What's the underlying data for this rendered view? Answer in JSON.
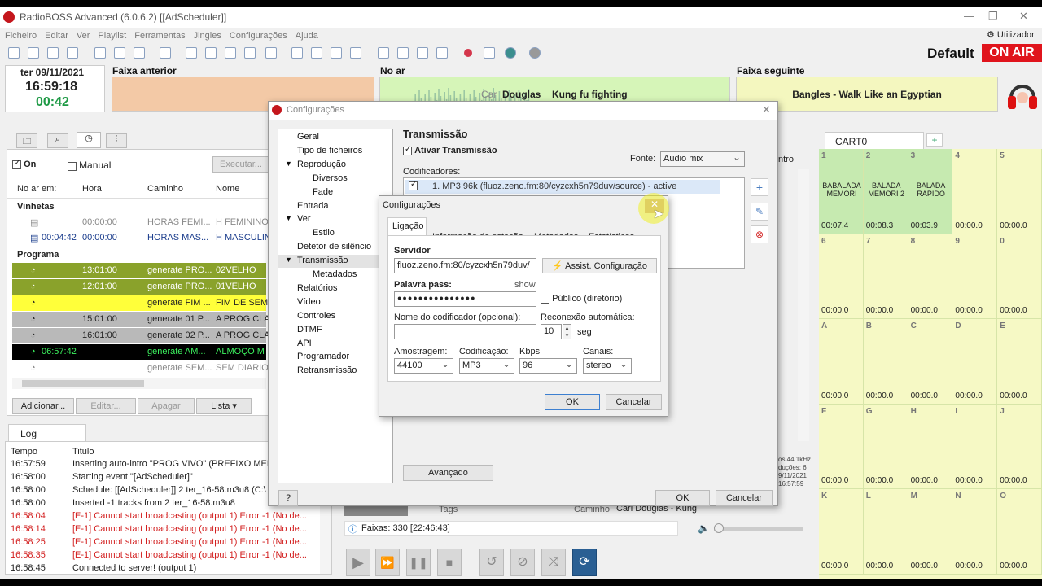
{
  "app": {
    "title": "RadioBOSS Advanced (6.0.6.2) [[AdScheduler]]",
    "user": "Utilizador",
    "profile": "Default",
    "on_air": "ON AIR"
  },
  "menu": [
    "Ficheiro",
    "Editar",
    "Ver",
    "Playlist",
    "Ferramentas",
    "Jingles",
    "Configurações",
    "Ajuda"
  ],
  "clock": {
    "date": "ter 09/11/2021",
    "time": "16:59:18",
    "remaining": "00:42"
  },
  "tracks": {
    "prev_label": "Faixa anterior",
    "now_label": "No ar",
    "now_artist_partial": "Car",
    "now_artist": "Douglas",
    "now_title": "Kung fu fighting",
    "next_label": "Faixa seguinte",
    "next_title": "Bangles - Walk Like an Egyptian"
  },
  "scheduler": {
    "on": "On",
    "manual": "Manual",
    "execute": "Executar...",
    "headers": [
      "No ar em:",
      "Hora",
      "Caminho",
      "Nome"
    ],
    "group1": "Vinhetas",
    "group2": "Programa",
    "rows": [
      {
        "onair": "",
        "hora": "00:00:00",
        "caminho": "HORAS FEMI...",
        "nome": "H FEMININO"
      },
      {
        "onair": "00:04:42",
        "hora": "00:00:00",
        "caminho": "HORAS MAS...",
        "nome": "H MASCULIN"
      },
      {
        "onair": "",
        "hora": "13:01:00",
        "caminho": "generate PRO...",
        "nome": "02VELHO"
      },
      {
        "onair": "",
        "hora": "12:01:00",
        "caminho": "generate PRO...",
        "nome": "01VELHO"
      },
      {
        "onair": "",
        "hora": "",
        "caminho": "generate FIM ...",
        "nome": "FIM DE SEM"
      },
      {
        "onair": "",
        "hora": "15:01:00",
        "caminho": "generate 01 P...",
        "nome": "A PROG CLA"
      },
      {
        "onair": "",
        "hora": "16:01:00",
        "caminho": "generate 02 P...",
        "nome": "A PROG CLA"
      },
      {
        "onair": "06:57:42",
        "hora": "",
        "caminho": "generate AM...",
        "nome": "ALMOÇO M"
      },
      {
        "onair": "",
        "hora": "",
        "caminho": "generate SEM...",
        "nome": "SEM DIARIO"
      }
    ],
    "buttons": {
      "add": "Adicionar...",
      "edit": "Editar...",
      "delete": "Apagar",
      "list": "Lista"
    }
  },
  "log": {
    "tab": "Log",
    "headers": [
      "Tempo",
      "Titulo"
    ],
    "rows": [
      {
        "t": "16:57:59",
        "m": "Inserting auto-intro \"PROG VIVO\" (PREFIXO MEN",
        "err": false
      },
      {
        "t": "16:58:00",
        "m": "Starting event \"[AdScheduler]\"",
        "err": false
      },
      {
        "t": "16:58:00",
        "m": "Schedule: [[AdScheduler]] 2 ter_16-58.m3u8 (C:\\",
        "err": false
      },
      {
        "t": "16:58:00",
        "m": "Inserted -1 tracks from 2 ter_16-58.m3u8",
        "err": false
      },
      {
        "t": "16:58:04",
        "m": "[E-1] Cannot start broadcasting (output 1) Error -1 (No de...",
        "err": true
      },
      {
        "t": "16:58:14",
        "m": "[E-1] Cannot start broadcasting (output 1) Error -1 (No de...",
        "err": true
      },
      {
        "t": "16:58:25",
        "m": "[E-1] Cannot start broadcasting (output 1) Error -1 (No de...",
        "err": true
      },
      {
        "t": "16:58:35",
        "m": "[E-1] Cannot start broadcasting (output 1) Error -1 (No de...",
        "err": true
      },
      {
        "t": "16:58:45",
        "m": "Connected to server! (output 1)",
        "err": false
      }
    ]
  },
  "player": {
    "tags": "Tags",
    "caminho": "Caminho",
    "path": "Carl Douglas - Kung",
    "faixas": "Faixas: 330 [22:46:43]",
    "info1": "os 44.1kHz",
    "info2": "duções: 6",
    "info3": "9/11/2021",
    "info4": "16:57:59",
    "ntro": "ntro"
  },
  "cart": {
    "tab": "CART0",
    "cells": [
      {
        "n": "1",
        "t": "BABALADA MEMORI",
        "d": "00:07.4"
      },
      {
        "n": "2",
        "t": "BALADA MEMORI 2",
        "d": "00:08.3"
      },
      {
        "n": "3",
        "t": "BALADA RAPIDO",
        "d": "00:03.9"
      },
      {
        "n": "4",
        "t": "",
        "d": "00:00.0"
      },
      {
        "n": "5",
        "t": "",
        "d": "00:00.0"
      },
      {
        "n": "6",
        "t": "",
        "d": "00:00.0"
      },
      {
        "n": "7",
        "t": "",
        "d": "00:00.0"
      },
      {
        "n": "8",
        "t": "",
        "d": "00:00.0"
      },
      {
        "n": "9",
        "t": "",
        "d": "00:00.0"
      },
      {
        "n": "0",
        "t": "",
        "d": "00:00.0"
      },
      {
        "n": "A",
        "t": "",
        "d": "00:00.0"
      },
      {
        "n": "B",
        "t": "",
        "d": "00:00.0"
      },
      {
        "n": "C",
        "t": "",
        "d": "00:00.0"
      },
      {
        "n": "D",
        "t": "",
        "d": "00:00.0"
      },
      {
        "n": "E",
        "t": "",
        "d": "00:00.0"
      },
      {
        "n": "F",
        "t": "",
        "d": "00:00.0"
      },
      {
        "n": "G",
        "t": "",
        "d": "00:00.0"
      },
      {
        "n": "H",
        "t": "",
        "d": "00:00.0"
      },
      {
        "n": "I",
        "t": "",
        "d": "00:00.0"
      },
      {
        "n": "J",
        "t": "",
        "d": "00:00.0"
      },
      {
        "n": "K",
        "t": "",
        "d": "00:00.0"
      },
      {
        "n": "L",
        "t": "",
        "d": "00:00.0"
      },
      {
        "n": "M",
        "t": "",
        "d": "00:00.0"
      },
      {
        "n": "N",
        "t": "",
        "d": "00:00.0"
      },
      {
        "n": "O",
        "t": "",
        "d": "00:00.0"
      }
    ]
  },
  "settings": {
    "title": "Configurações",
    "tree": [
      "Geral",
      "Tipo de ficheiros",
      "Reprodução",
      "Diversos",
      "Fade",
      "Entrada",
      "Ver",
      "Estilo",
      "Detetor de silêncio",
      "Transmissão",
      "Metadados",
      "Relatórios",
      "Vídeo",
      "Controles",
      "DTMF",
      "API",
      "Programador",
      "Retransmissão"
    ],
    "section": "Transmissão",
    "enable": "Ativar Transmissão",
    "source_label": "Fonte:",
    "source": "Audio mix",
    "encoders_label": "Codificadores:",
    "encoder_item": "1. MP3 96k (fluoz.zeno.fm:80/cyzcxh5n79duv/source) - active",
    "advanced": "Avançado",
    "ok": "OK",
    "cancel": "Cancelar",
    "help": "?"
  },
  "encoder": {
    "title": "Configurações",
    "tabs": [
      "Ligação",
      "Informação da estação",
      "Metadados",
      "Estatísticas"
    ],
    "server_label": "Servidor",
    "server": "fluoz.zeno.fm:80/cyzcxh5n79duv/",
    "assist": "Assist. Configuração",
    "pass_label": "Palavra pass:",
    "show": "show",
    "pass": "●●●●●●●●●●●●●●●",
    "public": "Público (diretório)",
    "name_label": "Nome do codificador (opcional):",
    "name": "",
    "reconnect_label": "Reconexão automática:",
    "reconnect": "10",
    "seg": "seg",
    "sample_label": "Amostragem:",
    "sample": "44100",
    "codec_label": "Codificação:",
    "codec": "MP3",
    "kbps_label": "Kbps",
    "kbps": "96",
    "channels_label": "Canais:",
    "channels": "stereo",
    "ok": "OK",
    "cancel": "Cancelar"
  },
  "colors": {
    "prev_track": "#f3c9a6",
    "now_green": "#d6f5b8",
    "next_yellow": "#f4f7bf",
    "cart_green": "#c6eab0",
    "cart_yellow": "#f6f9c5",
    "on_air_red": "#e0141c",
    "row_olive": "#8aa22b",
    "row_yellow": "#ffff3a",
    "row_grey": "#b9b9b9"
  }
}
